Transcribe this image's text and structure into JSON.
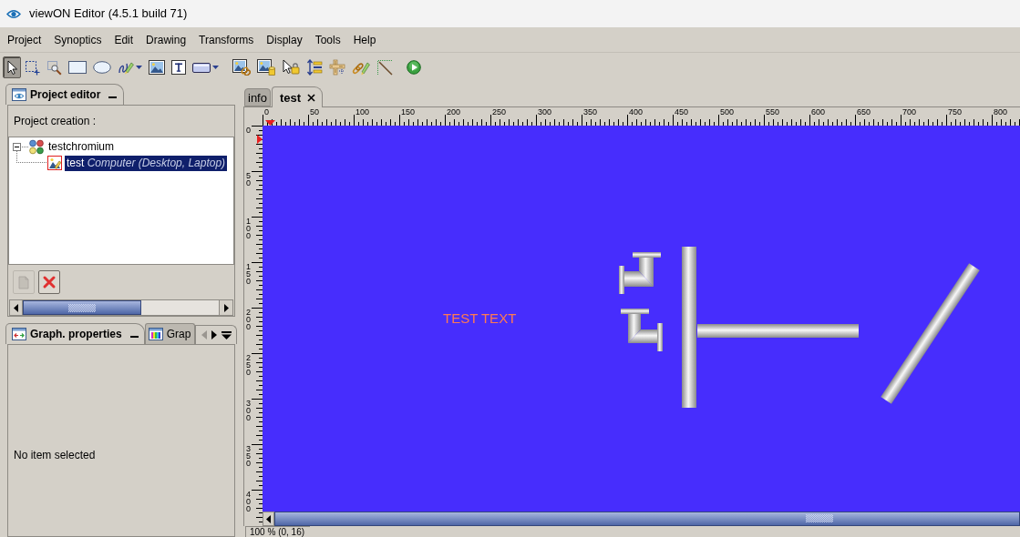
{
  "window": {
    "title": "viewON Editor (4.5.1 build 71)"
  },
  "menu": [
    "Project",
    "Synoptics",
    "Edit",
    "Drawing",
    "Transforms",
    "Display",
    "Tools",
    "Help"
  ],
  "toolbar": {
    "groups": [
      [
        {
          "pressed": true,
          "dropdown": false
        },
        {
          "pressed": false,
          "dropdown": false
        },
        {
          "pressed": false,
          "dropdown": false
        },
        {
          "pressed": false,
          "dropdown": false
        },
        {
          "pressed": false,
          "dropdown": false
        },
        {
          "pressed": false,
          "dropdown": true
        },
        {
          "pressed": false,
          "dropdown": false
        },
        {
          "pressed": false,
          "dropdown": false
        },
        {
          "pressed": false,
          "dropdown": true
        }
      ],
      [
        {
          "pressed": false,
          "dropdown": false
        },
        {
          "pressed": false,
          "dropdown": false
        },
        {
          "pressed": false,
          "dropdown": false
        },
        {
          "pressed": false,
          "dropdown": false
        },
        {
          "pressed": false,
          "dropdown": false
        },
        {
          "pressed": false,
          "dropdown": false
        },
        {
          "pressed": false,
          "dropdown": false
        }
      ],
      [
        {
          "pressed": false,
          "dropdown": false
        }
      ]
    ]
  },
  "project_editor": {
    "tabs": [
      {
        "label": "Project editor",
        "selected": true
      }
    ],
    "caption": "Project creation :",
    "tree": [
      {
        "label": "testchromium",
        "selected": false,
        "expanded": true,
        "children": [
          {
            "label": "test",
            "detail": "Computer (Desktop, Laptop)",
            "selected": true
          }
        ]
      }
    ],
    "buttons": [
      {
        "disabled": true
      },
      {
        "disabled": false
      }
    ]
  },
  "properties_panel": {
    "tabs": [
      {
        "label": "Graph. properties",
        "selected": true
      },
      {
        "label": "Grap",
        "selected": false
      }
    ],
    "tab_scroll": {
      "back_enabled": false,
      "forward_enabled": true
    },
    "message": "No item selected"
  },
  "editor": {
    "tabs": [
      {
        "label": "info",
        "selected": false,
        "closable": false
      },
      {
        "label": "test",
        "selected": true,
        "closable": true
      }
    ],
    "horizontal_ruler": {
      "labels": [
        "0",
        "50",
        "100",
        "150",
        "200",
        "250",
        "300",
        "350",
        "400",
        "450",
        "500",
        "550",
        "600",
        "650",
        "700",
        "750",
        "800"
      ]
    },
    "vertical_ruler": {
      "labels": [
        "0",
        "50",
        "100",
        "150",
        "200",
        "250",
        "300",
        "350",
        "400"
      ]
    },
    "canvas": {
      "text": "TEST TEXT"
    },
    "status_bar": "100 % (0, 16)"
  }
}
